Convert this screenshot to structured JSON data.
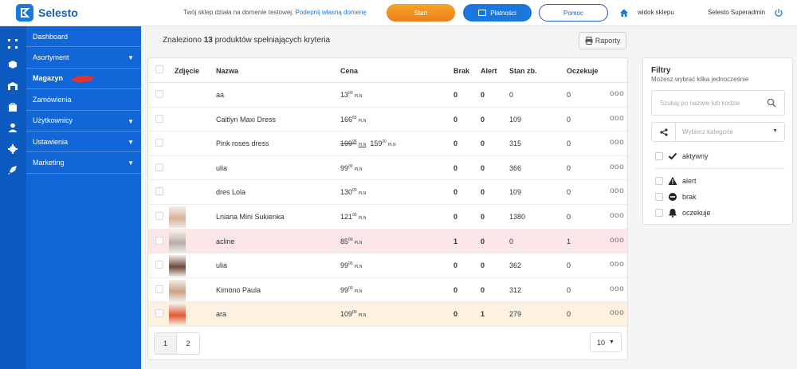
{
  "header": {
    "logo_text": "Selesto",
    "domain_note": "Twój sklep działa na domenie testowej.",
    "domain_link": "Podepnij własną domenę",
    "start_label": "Start",
    "payments_label": "Płatności",
    "help_label": "Pomoc",
    "store_view_label": "widok sklepu",
    "user_name": "Selesto Superadmin"
  },
  "sidebar": {
    "items": [
      {
        "label": "Dashboard",
        "icon": "dashboard-icon",
        "has_arrow": false
      },
      {
        "label": "Asortyment",
        "icon": "box-icon",
        "has_arrow": true
      },
      {
        "label": "Magazyn",
        "icon": "warehouse-icon",
        "has_arrow": false,
        "active": true
      },
      {
        "label": "Zamówienia",
        "icon": "bag-icon",
        "has_arrow": false
      },
      {
        "label": "Użytkownicy",
        "icon": "users-icon",
        "has_arrow": true
      },
      {
        "label": "Ustawienia",
        "icon": "gear-icon",
        "has_arrow": true
      },
      {
        "label": "Marketing",
        "icon": "rocket-icon",
        "has_arrow": true
      }
    ],
    "arrow_glyph": "▼"
  },
  "main": {
    "found_prefix": "Znaleziono",
    "found_count": "13",
    "found_suffix": "produktów spełniających kryteria",
    "reports_label": "Raporty",
    "columns": {
      "photo": "Zdjęcie",
      "name": "Nazwa",
      "price": "Cena",
      "missing": "Brak",
      "alert": "Alert",
      "stock": "Stan zb.",
      "waiting": "Oczekuje"
    },
    "rows": [
      {
        "name": "aa",
        "price_int": "13",
        "price_dec": "00",
        "currency": "PLN",
        "missing": "0",
        "alert": "0",
        "stock": "0",
        "waiting": "0",
        "thumb": false,
        "highlight": ""
      },
      {
        "name": "Caitlyn Maxi Dress",
        "price_int": "166",
        "price_dec": "65",
        "currency": "PLN",
        "missing": "0",
        "alert": "0",
        "stock": "109",
        "waiting": "0",
        "thumb": false,
        "highlight": ""
      },
      {
        "name": "Pink roses dress",
        "old_price_int": "199",
        "old_price_dec": "98",
        "price_int": "159",
        "price_dec": "20",
        "currency": "PLN",
        "missing": "0",
        "alert": "0",
        "stock": "315",
        "waiting": "0",
        "thumb": false,
        "highlight": ""
      },
      {
        "name": "ulia",
        "price_int": "99",
        "price_dec": "00",
        "currency": "PLN",
        "missing": "0",
        "alert": "0",
        "stock": "366",
        "waiting": "0",
        "thumb": false,
        "highlight": ""
      },
      {
        "name": "dres Lola",
        "price_int": "130",
        "price_dec": "00",
        "currency": "PLN",
        "missing": "0",
        "alert": "0",
        "stock": "109",
        "waiting": "0",
        "thumb": false,
        "highlight": ""
      },
      {
        "name": "Lniana Mini Sukienka",
        "price_int": "121",
        "price_dec": "00",
        "currency": "PLN",
        "missing": "0",
        "alert": "0",
        "stock": "1380",
        "waiting": "0",
        "thumb": true,
        "thumb_color": "#d8b39a",
        "highlight": ""
      },
      {
        "name": "acline",
        "price_int": "85",
        "price_dec": "00",
        "currency": "PLN",
        "missing": "1",
        "alert": "0",
        "stock": "0",
        "waiting": "1",
        "thumb": true,
        "thumb_color": "#b7aea4",
        "highlight": "red"
      },
      {
        "name": "ulia",
        "price_int": "99",
        "price_dec": "00",
        "currency": "PLN",
        "missing": "0",
        "alert": "0",
        "stock": "362",
        "waiting": "0",
        "thumb": true,
        "thumb_color": "#6b4a3c",
        "highlight": ""
      },
      {
        "name": "Kimono Paula",
        "price_int": "99",
        "price_dec": "00",
        "currency": "PLN",
        "missing": "0",
        "alert": "0",
        "stock": "312",
        "waiting": "0",
        "thumb": true,
        "thumb_color": "#c9a487",
        "highlight": ""
      },
      {
        "name": "ara",
        "price_int": "109",
        "price_dec": "00",
        "currency": "PLN",
        "missing": "0",
        "alert": "1",
        "stock": "279",
        "waiting": "0",
        "thumb": true,
        "thumb_color": "#e05a32",
        "highlight": "orange"
      }
    ],
    "more_glyph": "ooo",
    "pages": [
      "1",
      "2"
    ],
    "per_page": "10"
  },
  "filters": {
    "title": "Filtry",
    "subtitle": "Możesz wybrać kilka jednocześnie",
    "search_placeholder": "Szukaj po nazwie lub kodzie",
    "category_placeholder": "Wybierz kategorie",
    "options": [
      {
        "label": "aktywny",
        "icon": "checkmark-icon"
      },
      {
        "label": "alert",
        "icon": "warning-icon"
      },
      {
        "label": "brak",
        "icon": "minus-circle-icon"
      },
      {
        "label": "oczekuje",
        "icon": "bell-icon"
      }
    ]
  },
  "colors": {
    "accent": "#1a78dc",
    "sidebar": "#1167d8",
    "start_button": "#f0861f",
    "row_missing": "#fbe7e7",
    "row_alert": "#fdf1e1"
  }
}
